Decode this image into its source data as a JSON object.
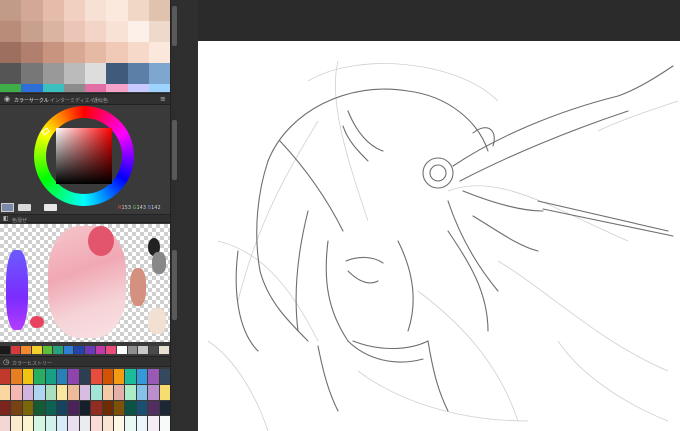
{
  "left_panel": {
    "color_set_tab": "カラーサークル",
    "subpanel_tab_1": "インターミディエイト",
    "subpanel_tab_2": "近似色",
    "color_history_tab": "カラーヒストリー",
    "mixing_tab": "色混ぜ",
    "rgb_readout": {
      "r": "153",
      "g": "143",
      "b": "142"
    },
    "top_palette_colors": [
      "#c29a88",
      "#d4a897",
      "#e5bcaa",
      "#f2d0c0",
      "#f7e0d4",
      "#fbe9de",
      "#f0d7c6",
      "#e0c2ae",
      "#b88c78",
      "#c8a08d",
      "#dab3a1",
      "#ebc5b5",
      "#f3d4c6",
      "#f8e2d6",
      "#fdf0e8",
      "#efd9cb",
      "#9c6f5f",
      "#b07f6d",
      "#c9947f",
      "#d9a892",
      "#e6b9a5",
      "#f1cab7",
      "#f6d9c9",
      "#fbe7db",
      "#555555",
      "#777777",
      "#999999",
      "#bbbbbb",
      "#dddddd",
      "#3f5a7a",
      "#5c7fa8",
      "#7ea6cf"
    ],
    "accent_colors": [
      "#3fae49",
      "#2d6fd6",
      "#3cbfbf",
      "#8c8c8c",
      "#e16fa5",
      "#f5a3c8",
      "#c9c9ff",
      "#9fd3ff"
    ],
    "palette_strip_colors": [
      "#1a1a1a",
      "#d73a3a",
      "#f08a2a",
      "#f3d02b",
      "#5fbf3a",
      "#2aa07a",
      "#2e7fd6",
      "#2444a8",
      "#6a3ab8",
      "#c23aa8",
      "#e94f7a",
      "#ffffff",
      "#8e8e8e",
      "#c8c8c8",
      "#4a4a4a",
      "#e8e0d0"
    ],
    "history_colors": [
      "#c0392b",
      "#e67e22",
      "#f1c40f",
      "#27ae60",
      "#16a085",
      "#2980b9",
      "#8e44ad",
      "#2c3e50",
      "#e74c3c",
      "#d35400",
      "#f39c12",
      "#1abc9c",
      "#3498db",
      "#9b59b6",
      "#34495e",
      "#fad7a0",
      "#f5b7b1",
      "#d2b4de",
      "#aed6f1",
      "#a9dfbf",
      "#f9e79f",
      "#edbb99",
      "#d7bde2",
      "#a3e4d7",
      "#f5cba7",
      "#e6b0aa",
      "#abebc6",
      "#85c1e9",
      "#bb8fce",
      "#f7dc6f",
      "#7b241c",
      "#784212",
      "#7d6608",
      "#145a32",
      "#0e6251",
      "#154360",
      "#4a235a",
      "#17202a",
      "#922b21",
      "#6e2c00",
      "#7e5109",
      "#0b5345",
      "#1b4f72",
      "#512e5f",
      "#1c2833",
      "#f2d7d5",
      "#fdebd0",
      "#fcf3cf",
      "#d5f5e3",
      "#d1f2eb",
      "#d6eaf8",
      "#ebdef0",
      "#eaecee",
      "#fadbd8",
      "#fae5d3",
      "#fef9e7",
      "#e8f8f5",
      "#ebf5fb",
      "#f4ecf7",
      "#f8f9f9"
    ]
  },
  "canvas": {
    "background": "#ffffff"
  }
}
